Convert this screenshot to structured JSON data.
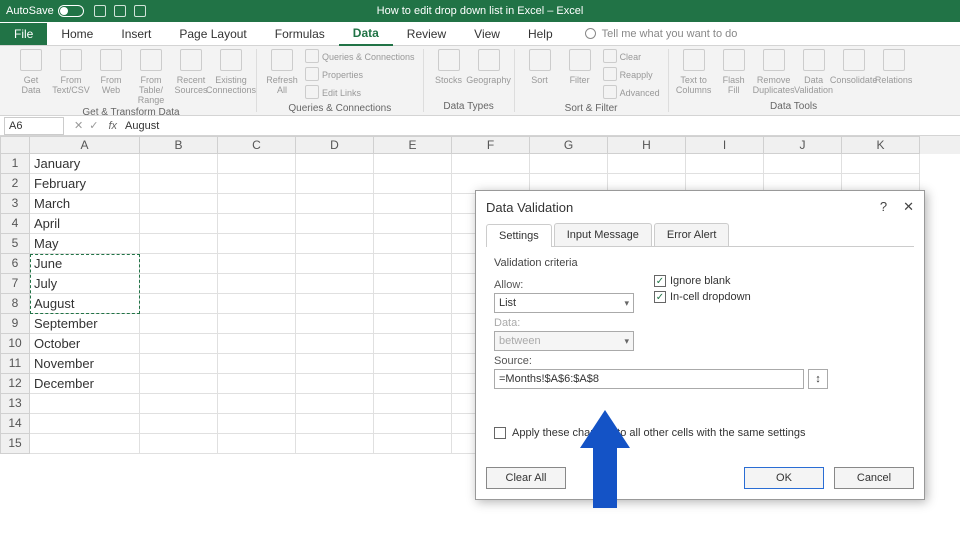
{
  "titlebar": {
    "autosave": "AutoSave",
    "toggle_state": "Off",
    "document_title": "How to edit drop down list in Excel – Excel"
  },
  "menu": {
    "file": "File",
    "items": [
      "Home",
      "Insert",
      "Page Layout",
      "Formulas",
      "Data",
      "Review",
      "View",
      "Help"
    ],
    "active": "Data",
    "tellme": "Tell me what you want to do"
  },
  "ribbon": {
    "groups": [
      {
        "label": "Get & Transform Data",
        "buttons": [
          "Get Data",
          "From Text/CSV",
          "From Web",
          "From Table/ Range",
          "Recent Sources",
          "Existing Connections"
        ]
      },
      {
        "label": "Queries & Connections",
        "buttons": [
          "Refresh All"
        ],
        "links": [
          "Queries & Connections",
          "Properties",
          "Edit Links"
        ]
      },
      {
        "label": "Data Types",
        "buttons": [
          "Stocks",
          "Geography"
        ]
      },
      {
        "label": "Sort & Filter",
        "buttons": [
          "Sort",
          "Filter"
        ],
        "links": [
          "Clear",
          "Reapply",
          "Advanced"
        ]
      },
      {
        "label": "Data Tools",
        "buttons": [
          "Text to Columns",
          "Flash Fill",
          "Remove Duplicates",
          "Data Validation",
          "Consolidate",
          "Relations"
        ]
      }
    ]
  },
  "fx": {
    "namebox": "A6",
    "value": "August"
  },
  "grid": {
    "columns": [
      "A",
      "B",
      "C",
      "D",
      "E",
      "F",
      "G",
      "H",
      "I",
      "J",
      "K"
    ],
    "rows": [
      1,
      2,
      3,
      4,
      5,
      6,
      7,
      8,
      9,
      10,
      11,
      12,
      13,
      14,
      15
    ],
    "colA": [
      "January",
      "February",
      "March",
      "April",
      "May",
      "June",
      "July",
      "August",
      "September",
      "October",
      "November",
      "December",
      "",
      "",
      ""
    ],
    "marching_selection": "A6:A8"
  },
  "dialog": {
    "title": "Data Validation",
    "tabs": [
      "Settings",
      "Input Message",
      "Error Alert"
    ],
    "active_tab": "Settings",
    "section": "Validation criteria",
    "allow_label": "Allow:",
    "allow_value": "List",
    "data_label": "Data:",
    "data_value": "between",
    "ignore_blank": "Ignore blank",
    "incell": "In-cell dropdown",
    "source_label": "Source:",
    "source_value": "=Months!$A$6:$A$8",
    "apply": "Apply these changes to all other cells with the same settings",
    "clear": "Clear All",
    "ok": "OK",
    "cancel": "Cancel"
  }
}
